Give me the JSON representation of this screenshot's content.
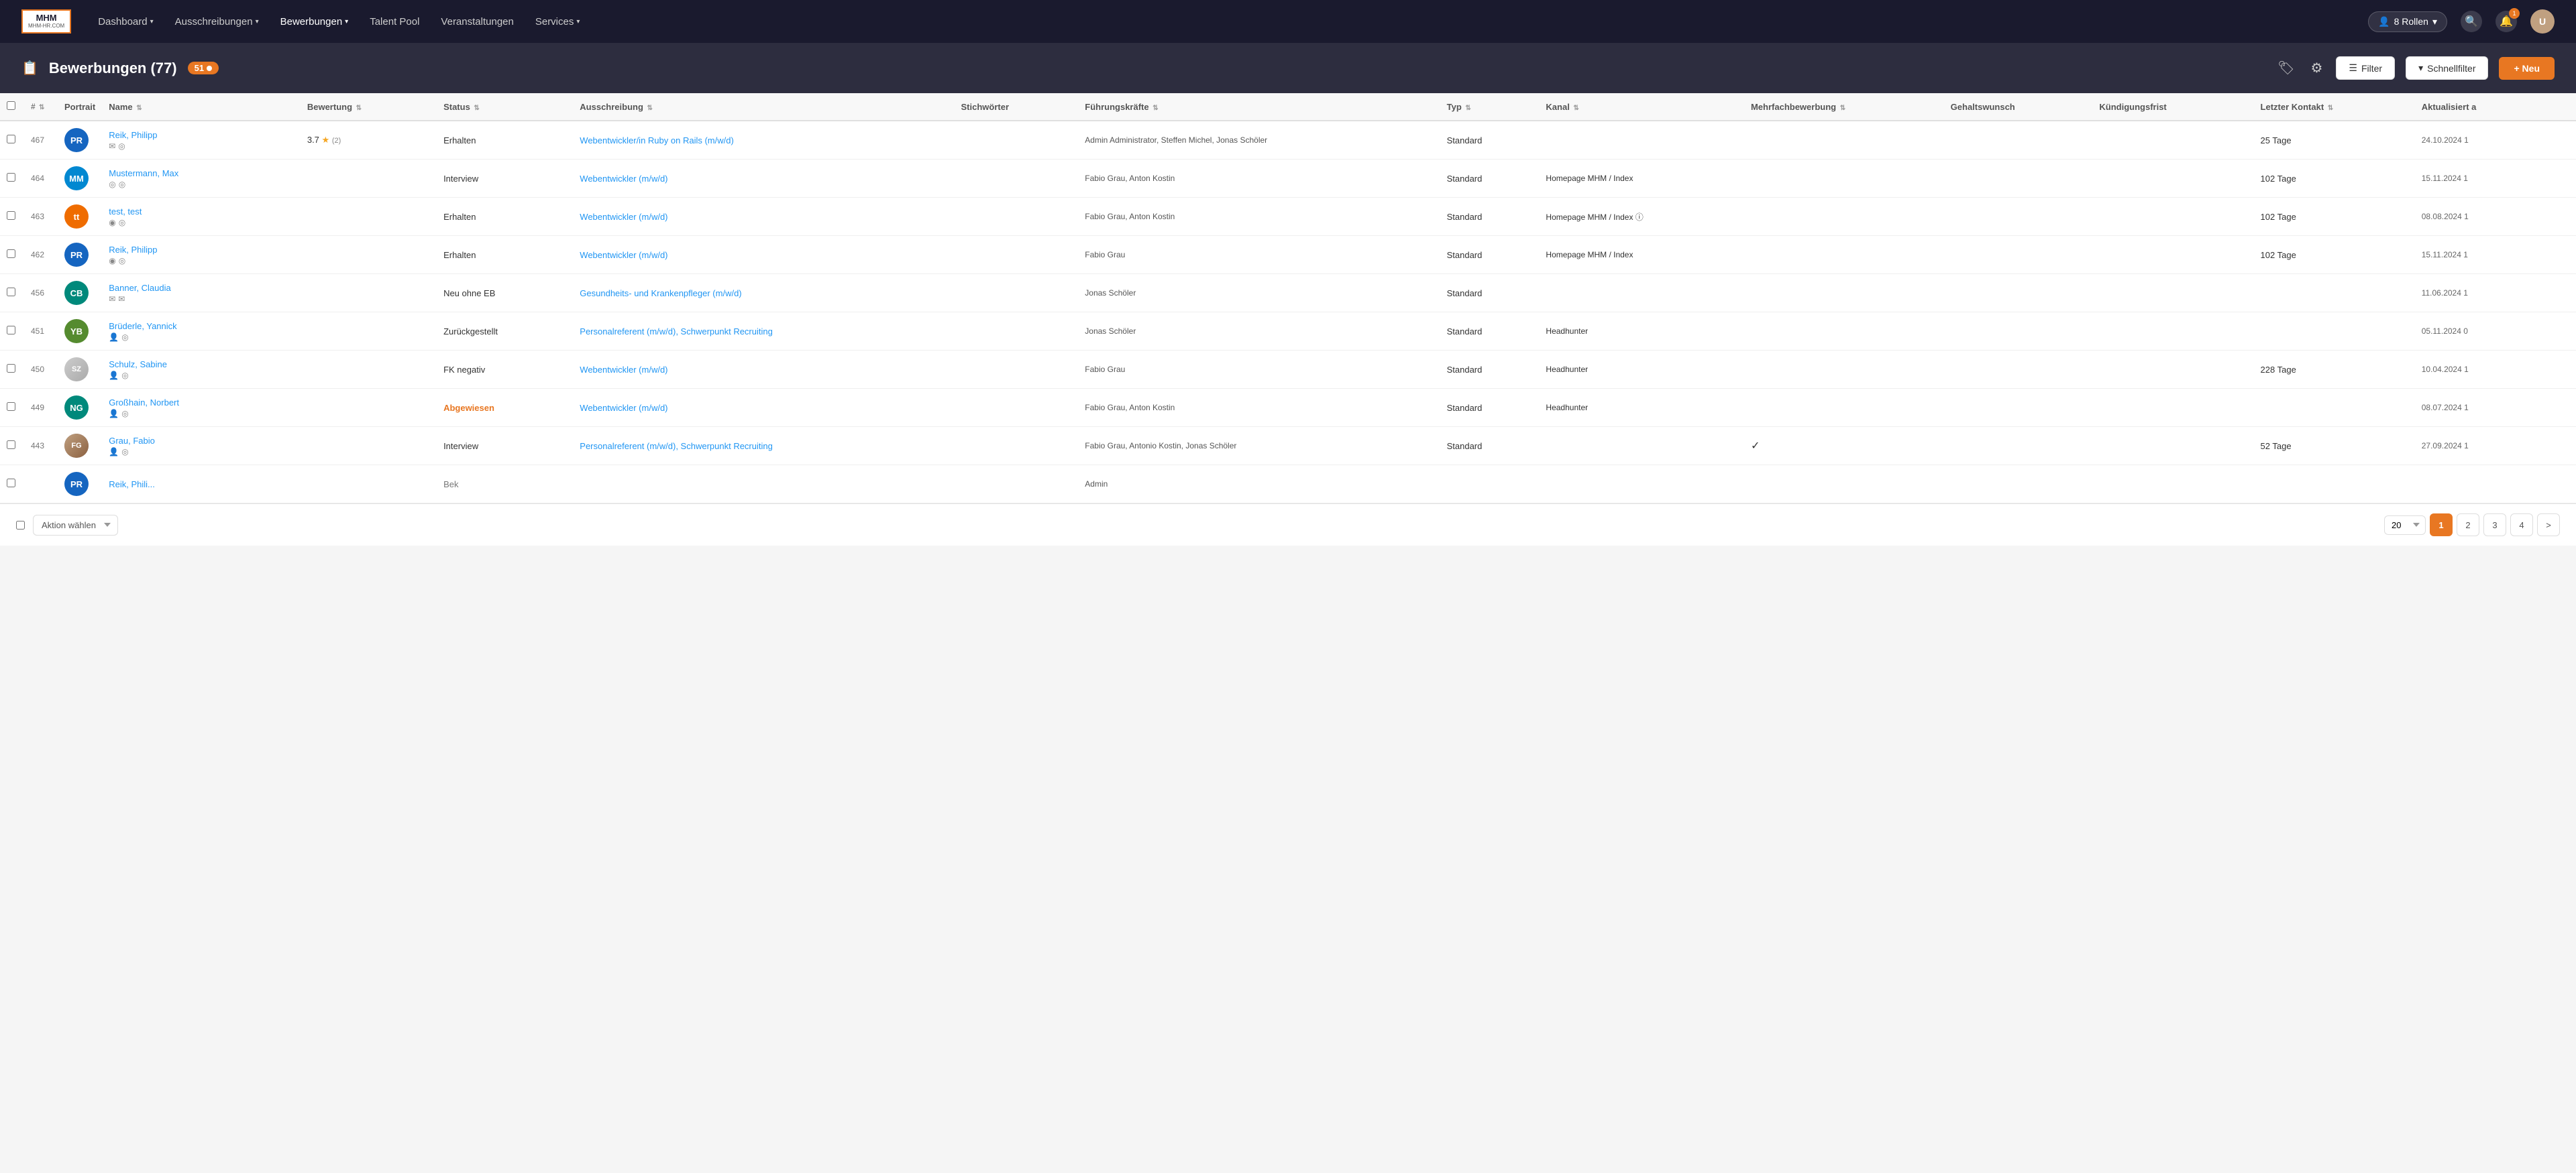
{
  "nav": {
    "logo_line1": "MHM",
    "logo_sub": "MHM-HR.COM",
    "links": [
      {
        "label": "Dashboard",
        "hasChevron": true,
        "active": false
      },
      {
        "label": "Ausschreibungen",
        "hasChevron": true,
        "active": false
      },
      {
        "label": "Bewerbungen",
        "hasChevron": true,
        "active": true
      },
      {
        "label": "Talent Pool",
        "hasChevron": false,
        "active": false
      },
      {
        "label": "Veranstaltungen",
        "hasChevron": false,
        "active": false
      },
      {
        "label": "Services",
        "hasChevron": true,
        "active": false
      }
    ],
    "roles_label": "8 Rollen",
    "notification_count": "1"
  },
  "page": {
    "title": "Bewerbungen (77)",
    "count": "51",
    "filter_label": "Filter",
    "schnellfilter_label": "Schnellfilter",
    "new_label": "+ Neu"
  },
  "table": {
    "columns": [
      {
        "key": "id",
        "label": "#"
      },
      {
        "key": "portrait",
        "label": "Portrait"
      },
      {
        "key": "name",
        "label": "Name"
      },
      {
        "key": "bewertung",
        "label": "Bewertung"
      },
      {
        "key": "status",
        "label": "Status"
      },
      {
        "key": "ausschreibung",
        "label": "Ausschreibung"
      },
      {
        "key": "stichworter",
        "label": "Stichwörter"
      },
      {
        "key": "fuhrung",
        "label": "Führungskräfte"
      },
      {
        "key": "typ",
        "label": "Typ"
      },
      {
        "key": "kanal",
        "label": "Kanal"
      },
      {
        "key": "mehrfach",
        "label": "Mehrfachbewerbung"
      },
      {
        "key": "gehalt",
        "label": "Gehaltswunsch"
      },
      {
        "key": "kundigung",
        "label": "Kündigungsfrist"
      },
      {
        "key": "letzter",
        "label": "Letzter Kontakt"
      },
      {
        "key": "aktualisiert",
        "label": "Aktualisiert a"
      }
    ],
    "rows": [
      {
        "id": "467",
        "initials": "PR",
        "avatar_color": "#1565c0",
        "name": "Reik, Philipp",
        "icons": [
          "✉",
          "◎"
        ],
        "rating": "3.7",
        "rating_stars": 1,
        "rating_count": "(2)",
        "status": "Erhalten",
        "status_color": "#333",
        "ausschreibung": "Webentwickler/in Ruby on Rails (m/w/d)",
        "stichworter": "",
        "fuhrung": "Admin Administrator, Steffen Michel, Jonas Schöler",
        "typ": "Standard",
        "kanal": "",
        "mehrfach": "",
        "gehalt": "",
        "kundigung": "",
        "letzter": "25 Tage",
        "letzter_red": true,
        "aktualisiert": "24.10.2024 1"
      },
      {
        "id": "464",
        "initials": "MM",
        "avatar_color": "#0288d1",
        "name": "Mustermann, Max",
        "icons": [
          "◎",
          "◎"
        ],
        "rating": "",
        "rating_stars": 0,
        "rating_count": "",
        "status": "Interview",
        "status_color": "#333",
        "ausschreibung": "Webentwickler (m/w/d)",
        "stichworter": "",
        "fuhrung": "Fabio Grau, Anton Kostin",
        "typ": "Standard",
        "kanal": "Homepage MHM / Index",
        "mehrfach": "",
        "gehalt": "",
        "kundigung": "",
        "letzter": "102 Tage",
        "letzter_red": true,
        "aktualisiert": "15.11.2024 1"
      },
      {
        "id": "463",
        "initials": "tt",
        "avatar_color": "#ef6c00",
        "name": "test, test",
        "icons": [
          "◉",
          "◎"
        ],
        "rating": "",
        "rating_stars": 0,
        "rating_count": "",
        "status": "Erhalten",
        "status_color": "#333",
        "ausschreibung": "Webentwickler (m/w/d)",
        "stichworter": "",
        "fuhrung": "Fabio Grau, Anton Kostin",
        "typ": "Standard",
        "kanal": "Homepage MHM / Index ⓘ",
        "mehrfach": "",
        "gehalt": "",
        "kundigung": "",
        "letzter": "102 Tage",
        "letzter_red": true,
        "aktualisiert": "08.08.2024 1"
      },
      {
        "id": "462",
        "initials": "PR",
        "avatar_color": "#1565c0",
        "name": "Reik, Philipp",
        "icons": [
          "◉",
          "◎"
        ],
        "rating": "",
        "rating_stars": 0,
        "rating_count": "",
        "status": "Erhalten",
        "status_color": "#333",
        "ausschreibung": "Webentwickler (m/w/d)",
        "stichworter": "",
        "fuhrung": "Fabio Grau",
        "typ": "Standard",
        "kanal": "Homepage MHM / Index",
        "mehrfach": "",
        "gehalt": "",
        "kundigung": "",
        "letzter": "102 Tage",
        "letzter_red": true,
        "aktualisiert": "15.11.2024 1"
      },
      {
        "id": "456",
        "initials": "CB",
        "avatar_color": "#00897b",
        "name": "Banner, Claudia",
        "icons": [
          "✉",
          "✉"
        ],
        "rating": "",
        "rating_stars": 0,
        "rating_count": "",
        "status": "Neu ohne EB",
        "status_color": "#333",
        "ausschreibung": "Gesundheits- und Krankenpfleger (m/w/d)",
        "stichworter": "",
        "fuhrung": "Jonas Schöler",
        "typ": "Standard",
        "kanal": "",
        "mehrfach": "",
        "gehalt": "",
        "kundigung": "",
        "letzter": "",
        "letzter_red": false,
        "aktualisiert": "11.06.2024 1"
      },
      {
        "id": "451",
        "initials": "YB",
        "avatar_color": "#558b2f",
        "name": "Brüderle, Yannick",
        "icons": [
          "👤",
          "◎"
        ],
        "rating": "",
        "rating_stars": 0,
        "rating_count": "",
        "status": "Zurückgestellt",
        "status_color": "#333",
        "ausschreibung": "Personalreferent (m/w/d), Schwerpunkt Recruiting",
        "stichworter": "",
        "fuhrung": "Jonas Schöler",
        "typ": "Standard",
        "kanal": "Headhunter",
        "mehrfach": "",
        "gehalt": "",
        "kundigung": "",
        "letzter": "",
        "letzter_red": false,
        "aktualisiert": "05.11.2024 0"
      },
      {
        "id": "450",
        "initials": "SZ",
        "avatar_color": "#bdbdbd",
        "name": "Schulz, Sabine",
        "icons": [
          "👤",
          "◎"
        ],
        "is_photo": true,
        "rating": "",
        "rating_stars": 0,
        "rating_count": "",
        "status": "FK negativ",
        "status_color": "#333",
        "ausschreibung": "Webentwickler (m/w/d)",
        "stichworter": "",
        "fuhrung": "Fabio Grau",
        "typ": "Standard",
        "kanal": "Headhunter",
        "mehrfach": "",
        "gehalt": "",
        "kundigung": "",
        "letzter": "228 Tage",
        "letzter_red": true,
        "aktualisiert": "10.04.2024 1"
      },
      {
        "id": "449",
        "initials": "NG",
        "avatar_color": "#00897b",
        "name": "Großhain, Norbert",
        "icons": [
          "👤",
          "◎"
        ],
        "rating": "",
        "rating_stars": 0,
        "rating_count": "",
        "status": "Abgewiesen",
        "status_color": "#e87722",
        "ausschreibung": "Webentwickler (m/w/d)",
        "stichworter": "",
        "fuhrung": "Fabio Grau, Anton Kostin",
        "typ": "Standard",
        "kanal": "Headhunter",
        "mehrfach": "",
        "gehalt": "",
        "kundigung": "",
        "letzter": "",
        "letzter_red": false,
        "aktualisiert": "08.07.2024 1"
      },
      {
        "id": "443",
        "initials": "FG",
        "avatar_color": "#795548",
        "name": "Grau, Fabio",
        "icons": [
          "👤",
          "◎"
        ],
        "is_real_photo": true,
        "rating": "",
        "rating_stars": 0,
        "rating_count": "",
        "status": "Interview",
        "status_color": "#333",
        "ausschreibung": "Personalreferent (m/w/d), Schwerpunkt Recruiting",
        "stichworter": "",
        "fuhrung": "Fabio Grau, Antonio Kostin, Jonas Schöler",
        "typ": "Standard",
        "kanal": "",
        "mehrfach": "✓",
        "gehalt": "",
        "kundigung": "",
        "letzter": "52 Tage",
        "letzter_red": true,
        "aktualisiert": "27.09.2024 1"
      }
    ],
    "partial_row": {
      "id": "",
      "name": "Reik, Phili...",
      "status": "Bek",
      "fuhrung": "Admin"
    }
  },
  "footer": {
    "action_label": "Aktion wählen",
    "page_size": "20",
    "pages": [
      "1",
      "2",
      "3",
      "4"
    ],
    "next_label": ">",
    "active_page": "1"
  }
}
